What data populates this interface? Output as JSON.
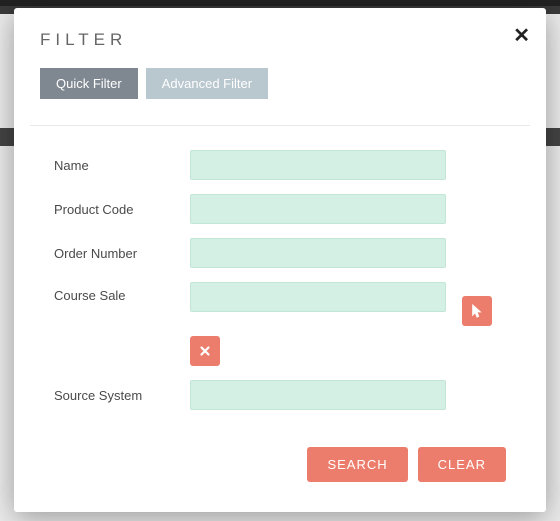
{
  "modal": {
    "title": "FILTER",
    "close_symbol": "✕"
  },
  "tabs": {
    "quick": "Quick Filter",
    "advanced": "Advanced Filter"
  },
  "fields": {
    "name": {
      "label": "Name",
      "value": ""
    },
    "product_code": {
      "label": "Product Code",
      "value": ""
    },
    "order_number": {
      "label": "Order Number",
      "value": ""
    },
    "course_sale": {
      "label": "Course Sale",
      "value": ""
    },
    "source_system": {
      "label": "Source System",
      "value": ""
    }
  },
  "buttons": {
    "search": "SEARCH",
    "clear": "CLEAR"
  }
}
